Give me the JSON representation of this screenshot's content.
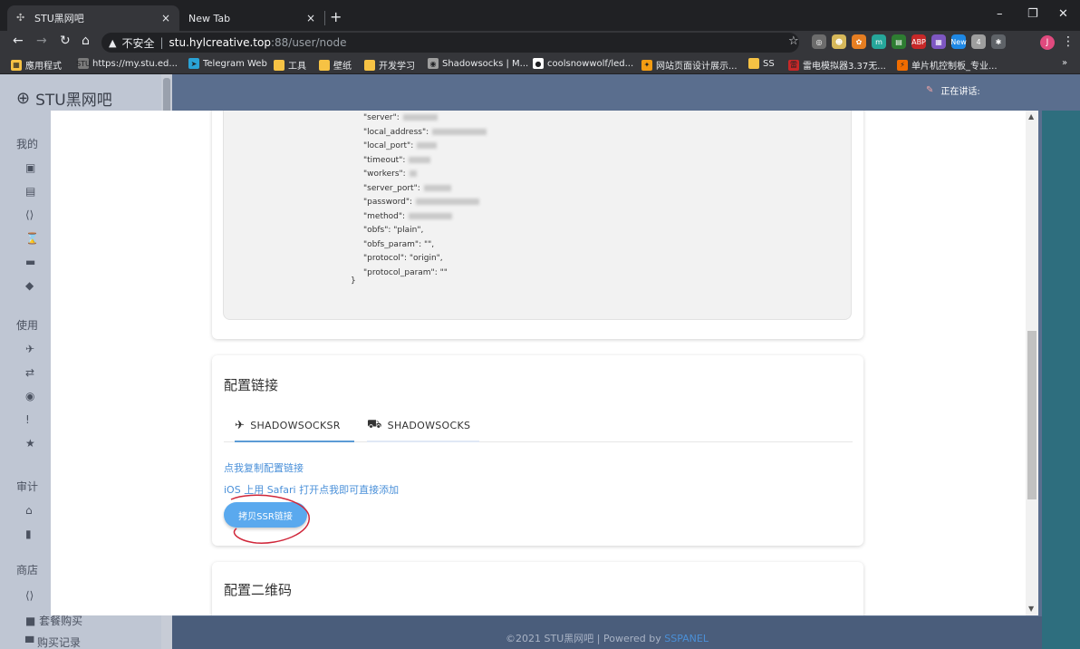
{
  "browser": {
    "tabs": [
      {
        "title": "STU黑网吧",
        "close": "×",
        "active": true
      },
      {
        "title": "New Tab",
        "close": "×",
        "active": false
      }
    ],
    "new_tab": "+",
    "window_controls": {
      "minimize": "–",
      "restore": "❐",
      "close": "✕"
    },
    "address": {
      "security_label": "不安全",
      "separator": "|",
      "host": "stu.hylcreative.top",
      "rest": ":88/user/node"
    },
    "extensions": [
      {
        "name": "ext-glasses",
        "label": "◎",
        "color": "#6c6c6c"
      },
      {
        "name": "ext-face",
        "label": "☻",
        "color": "#d6b85a"
      },
      {
        "name": "ext-flower",
        "label": "✿",
        "color": "#e67e22"
      },
      {
        "name": "ext-m",
        "label": "m",
        "color": "#26a69a"
      },
      {
        "name": "ext-note",
        "label": "▤",
        "color": "#2e7d32"
      },
      {
        "name": "ext-abp",
        "label": "ABP",
        "color": "#c62828"
      },
      {
        "name": "ext-boxes",
        "label": "▦",
        "color": "#7e57c2"
      },
      {
        "name": "ext-new",
        "label": "New",
        "color": "#1e88e5"
      },
      {
        "name": "ext-g4",
        "label": "4",
        "color": "#9e9e9e"
      },
      {
        "name": "ext-puzzle",
        "label": "✱",
        "color": "#5f6368"
      }
    ],
    "profile_initial": "J",
    "bookmarks": [
      {
        "label": "應用程式",
        "icon": "▦",
        "icon_color": "#f6c244"
      },
      {
        "label": "https://my.stu.ed...",
        "icon": "STU",
        "icon_color": "#7a7a7a"
      },
      {
        "label": "Telegram Web",
        "icon": "➤",
        "icon_color": "#2aa3d6"
      },
      {
        "label": "工具",
        "icon": "",
        "icon_color": "#f6c244"
      },
      {
        "label": "壁纸",
        "icon": "",
        "icon_color": "#f6c244"
      },
      {
        "label": "开发学习",
        "icon": "",
        "icon_color": "#f6c244"
      },
      {
        "label": "Shadowsocks | M...",
        "icon": "◉",
        "icon_color": "#9e9e9e"
      },
      {
        "label": "coolsnowwolf/led...",
        "icon": "●",
        "icon_color": "#ffffff"
      },
      {
        "label": "网站页面设计展示...",
        "icon": "✦",
        "icon_color": "#f39c12"
      },
      {
        "label": "SS",
        "icon": "",
        "icon_color": "#f6c244"
      },
      {
        "label": "雷电模拟器3.37无...",
        "icon": "雷",
        "icon_color": "#c62828"
      },
      {
        "label": "单片机控制板_专业...",
        "icon": "⚡",
        "icon_color": "#ef6c00"
      }
    ],
    "more_bookmarks": "»"
  },
  "sidebar": {
    "brand": "STU黑网吧",
    "sections": [
      "我的",
      "使用",
      "审计",
      "商店"
    ],
    "bottom_items": [
      "套餐购买",
      "购买记录"
    ]
  },
  "overlay": {
    "speaking_label": "正在讲话:"
  },
  "config_json": {
    "lines": [
      "\"server\":",
      "\"local_address\":",
      "\"local_port\":",
      "\"timeout\":",
      "\"workers\":",
      "\"server_port\":",
      "\"password\":",
      "\"method\":",
      "\"obfs\": \"plain\",",
      "\"obfs_param\": \"\",",
      "\"protocol\": \"origin\",",
      "\"protocol_param\": \"\""
    ],
    "close_brace": "}"
  },
  "config_link_card": {
    "title": "配置链接",
    "tabs": [
      {
        "label": "SHADOWSOCKSR",
        "icon": "✈"
      },
      {
        "label": "SHADOWSOCKS",
        "icon": "⛟"
      }
    ],
    "copy_link": "点我复制配置链接",
    "ios_link": "iOS 上用 Safari 打开点我即可直接添加",
    "copy_ssr_button": "拷贝SSR链接"
  },
  "qr_card": {
    "title": "配置二维码"
  },
  "footer": {
    "text": "©2021 STU黑网吧 | Powered by ",
    "powered": "SSPANEL"
  },
  "colors": {
    "accent": "#5aa9ee",
    "link": "#4a90d9",
    "annotation": "#d0273a"
  }
}
